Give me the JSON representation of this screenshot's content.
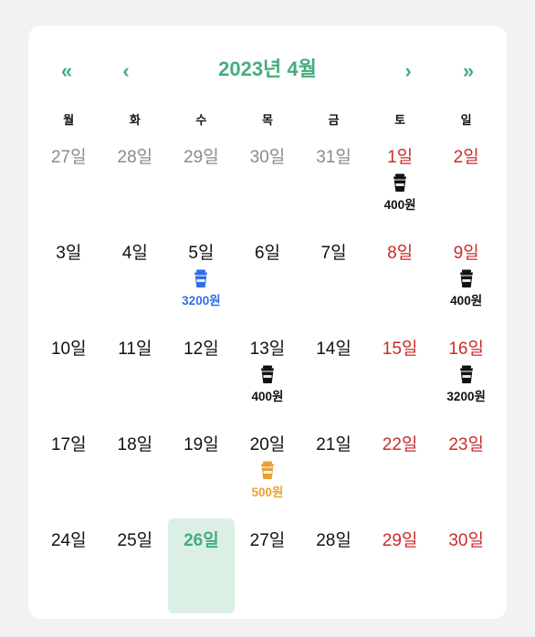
{
  "header": {
    "title": "2023년 4월",
    "prev_year_label": "«",
    "prev_month_label": "‹",
    "next_month_label": "›",
    "next_year_label": "»"
  },
  "weekdays": [
    "월",
    "화",
    "수",
    "목",
    "금",
    "토",
    "일"
  ],
  "colors": {
    "accent": "#45ad7c",
    "weekend": "#cc2b2b",
    "other_month": "#8a8a8a",
    "today_bg": "#dcefe4",
    "entry_black": "#111111",
    "entry_blue": "#2f6ee8",
    "entry_orange": "#e8a135"
  },
  "weeks": [
    [
      {
        "label": "27일",
        "other": true
      },
      {
        "label": "28일",
        "other": true
      },
      {
        "label": "29일",
        "other": true
      },
      {
        "label": "30일",
        "other": true
      },
      {
        "label": "31일",
        "other": true
      },
      {
        "label": "1일",
        "weekend": true,
        "entry": {
          "icon": "coffee-cup-icon",
          "amount": "400원",
          "color": "#111111"
        }
      },
      {
        "label": "2일",
        "weekend": true
      }
    ],
    [
      {
        "label": "3일"
      },
      {
        "label": "4일"
      },
      {
        "label": "5일",
        "entry": {
          "icon": "coffee-cup-icon",
          "amount": "3200원",
          "color": "#2f6ee8"
        }
      },
      {
        "label": "6일"
      },
      {
        "label": "7일"
      },
      {
        "label": "8일",
        "weekend": true
      },
      {
        "label": "9일",
        "weekend": true,
        "entry": {
          "icon": "coffee-cup-icon",
          "amount": "400원",
          "color": "#111111"
        }
      }
    ],
    [
      {
        "label": "10일"
      },
      {
        "label": "11일"
      },
      {
        "label": "12일"
      },
      {
        "label": "13일",
        "entry": {
          "icon": "coffee-cup-icon",
          "amount": "400원",
          "color": "#111111"
        }
      },
      {
        "label": "14일"
      },
      {
        "label": "15일",
        "weekend": true
      },
      {
        "label": "16일",
        "weekend": true,
        "entry": {
          "icon": "coffee-cup-icon",
          "amount": "3200원",
          "color": "#111111"
        }
      }
    ],
    [
      {
        "label": "17일"
      },
      {
        "label": "18일"
      },
      {
        "label": "19일"
      },
      {
        "label": "20일",
        "entry": {
          "icon": "coffee-cup-icon",
          "amount": "500원",
          "color": "#e8a135"
        }
      },
      {
        "label": "21일"
      },
      {
        "label": "22일",
        "weekend": true
      },
      {
        "label": "23일",
        "weekend": true
      }
    ],
    [
      {
        "label": "24일"
      },
      {
        "label": "25일"
      },
      {
        "label": "26일",
        "today": true
      },
      {
        "label": "27일"
      },
      {
        "label": "28일"
      },
      {
        "label": "29일",
        "weekend": true
      },
      {
        "label": "30일",
        "weekend": true
      }
    ]
  ]
}
